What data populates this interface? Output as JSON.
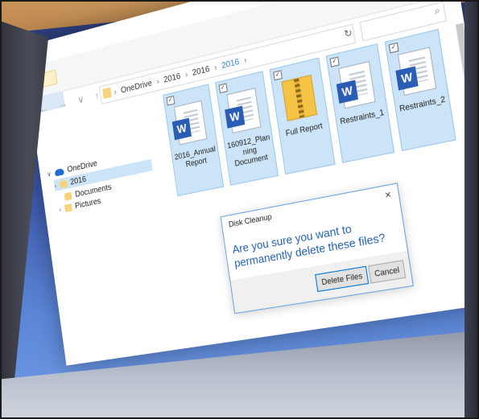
{
  "window": {
    "controls": {
      "minimize": "–",
      "maximize": "☐",
      "close": "✕"
    }
  },
  "address": {
    "crumbs": [
      "OneDrive",
      "2016",
      "2016",
      "2016"
    ],
    "separator": "›",
    "refresh": "↻",
    "nav": "← → ∨ ↑"
  },
  "search": {
    "icon": "search-icon",
    "glyph": "⌕"
  },
  "sidebar": {
    "items": [
      {
        "label": "OneDrive",
        "icon": "cloud-icon",
        "chevron": "∨"
      },
      {
        "label": "2016",
        "icon": "folder-icon",
        "chevron": "›",
        "selected": true
      },
      {
        "label": "Documents",
        "icon": "folder-icon",
        "chevron": ""
      },
      {
        "label": "Pictures",
        "icon": "folder-icon",
        "chevron": "›"
      }
    ]
  },
  "files": [
    {
      "name": "2016_Annual Report",
      "type": "word",
      "badge": "W",
      "checked": "✓"
    },
    {
      "name": "160912_Planning Document",
      "type": "word",
      "badge": "W",
      "checked": "✓"
    },
    {
      "name": "Full Report",
      "type": "zip",
      "badge": "",
      "checked": "✓"
    },
    {
      "name": "Restraints_1",
      "type": "word",
      "badge": "W",
      "checked": "✓"
    },
    {
      "name": "Restraints_2",
      "type": "word",
      "badge": "W",
      "checked": "✓"
    }
  ],
  "dialog": {
    "title": "Disk Cleanup",
    "close": "×",
    "message": "Are you sure you want to permanently delete these files?",
    "delete_label": "Delete Files",
    "cancel_label": "Cancel"
  },
  "colors": {
    "selection": "#cce4f7",
    "accent": "#1f5fb0",
    "word_blue": "#2b5db4",
    "zip_yellow": "#f5c346"
  }
}
